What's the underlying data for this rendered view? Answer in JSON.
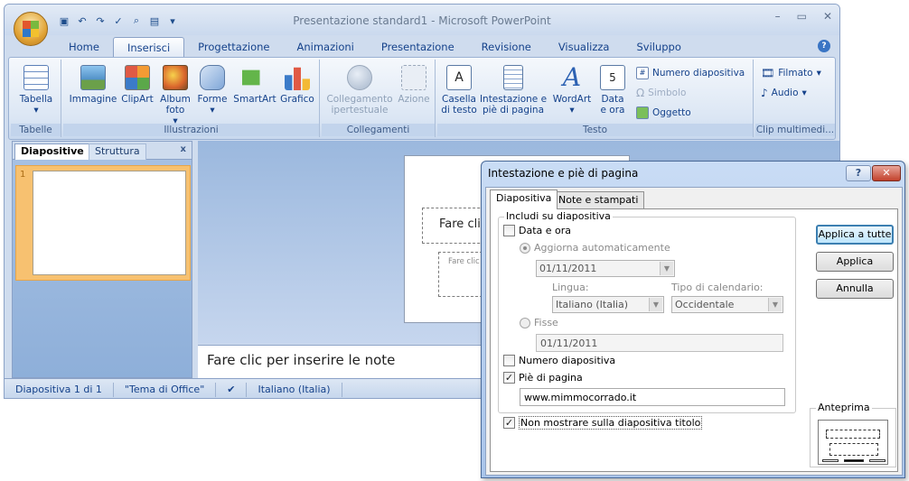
{
  "window": {
    "title": "Presentazione standard1 - Microsoft PowerPoint",
    "controls": [
      "–",
      "▭",
      "✕"
    ]
  },
  "quick_access": [
    "save-icon",
    "undo-icon",
    "redo-icon",
    "spelling-icon",
    "print-preview-icon",
    "textbox-icon",
    "customize-icon"
  ],
  "ribbon_tabs": [
    "Home",
    "Inserisci",
    "Progettazione",
    "Animazioni",
    "Presentazione",
    "Revisione",
    "Visualizza",
    "Sviluppo"
  ],
  "active_tab": "Inserisci",
  "ribbon": {
    "tabelle": {
      "label": "Tabelle",
      "tabella": "Tabella"
    },
    "illustrazioni": {
      "label": "Illustrazioni",
      "immagine": "Immagine",
      "clipart": "ClipArt",
      "album": "Album",
      "album2": "foto",
      "forme": "Forme",
      "smartart": "SmartArt",
      "grafico": "Grafico"
    },
    "collegamenti": {
      "label": "Collegamenti",
      "collegamento": "Collegamento",
      "collegamento2": "ipertestuale",
      "azione": "Azione"
    },
    "testo": {
      "label": "Testo",
      "casella": "Casella",
      "casella2": "di testo",
      "intestazione": "Intestazione e",
      "intestazione2": "piè di pagina",
      "wordart": "WordArt",
      "data": "Data",
      "data2": "e ora",
      "numero": "Numero diapositiva",
      "simbolo": "Simbolo",
      "oggetto": "Oggetto"
    },
    "clip": {
      "label": "Clip multimedi...",
      "filmato": "Filmato",
      "audio": "Audio"
    }
  },
  "pane": {
    "tab_active": "Diapositive",
    "tab_inactive": "Struttura",
    "close": "x",
    "slide_number": "1"
  },
  "slide": {
    "title_placeholder": "Fare clic",
    "subtitle_placeholder": "Fare clic"
  },
  "notes": "Fare clic per inserire le note",
  "status": {
    "slide": "Diapositiva 1 di 1",
    "theme": "\"Tema di Office\"",
    "language": "Italiano (Italia)"
  },
  "dialog": {
    "title": "Intestazione e piè di pagina",
    "help": "?",
    "close": "✕",
    "tabs": [
      "Diapositiva",
      "Note e stampati"
    ],
    "group_label": "Includi su diapositiva",
    "data_e_ora": {
      "label": "Data e ora",
      "checked": false
    },
    "aggiorna": {
      "label": "Aggiorna automaticamente",
      "selected": true
    },
    "date_auto": "01/11/2011",
    "lingua_label": "Lingua:",
    "lingua_value": "Italiano (Italia)",
    "calendario_label": "Tipo di calendario:",
    "calendario_value": "Occidentale",
    "fisse": {
      "label": "Fisse",
      "selected": false
    },
    "date_fixed": "01/11/2011",
    "numero": {
      "label": "Numero diapositiva",
      "checked": false
    },
    "pie": {
      "label": "Piè di pagina",
      "checked": true
    },
    "footer_text": "www.mimmocorrado.it",
    "non_mostrare": {
      "label": "Non mostrare sulla diapositiva titolo",
      "checked": true
    },
    "buttons": {
      "applica_tutte": "Applica a tutte",
      "applica": "Applica",
      "annulla": "Annulla"
    },
    "preview_label": "Anteprima"
  }
}
